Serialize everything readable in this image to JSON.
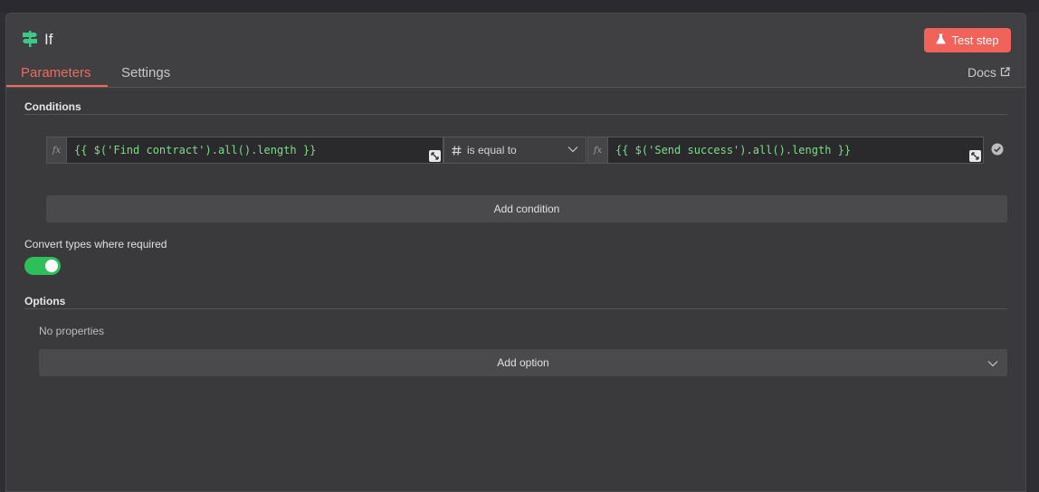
{
  "node": {
    "title": "If",
    "test_button_label": "Test step",
    "icon": "signpost-icon",
    "icon_color": "#3fc78a"
  },
  "tabs": [
    {
      "label": "Parameters",
      "active": true
    },
    {
      "label": "Settings",
      "active": false
    }
  ],
  "docs_label": "Docs",
  "conditions": {
    "section_label": "Conditions",
    "rows": [
      {
        "left_value": "{{ $('Find contract').all().length }}",
        "operator_type_icon": "hash-icon",
        "operator": "is equal to",
        "right_value": "{{ $('Send success').all().length }}"
      }
    ],
    "add_condition_label": "Add condition"
  },
  "convert_types": {
    "label": "Convert types where required",
    "enabled": true
  },
  "options": {
    "section_label": "Options",
    "empty_text": "No properties",
    "add_option_label": "Add option"
  },
  "colors": {
    "accent": "#f06a5e",
    "toggle_on": "#2fbf5a",
    "expression_text": "#7ddc8c"
  }
}
